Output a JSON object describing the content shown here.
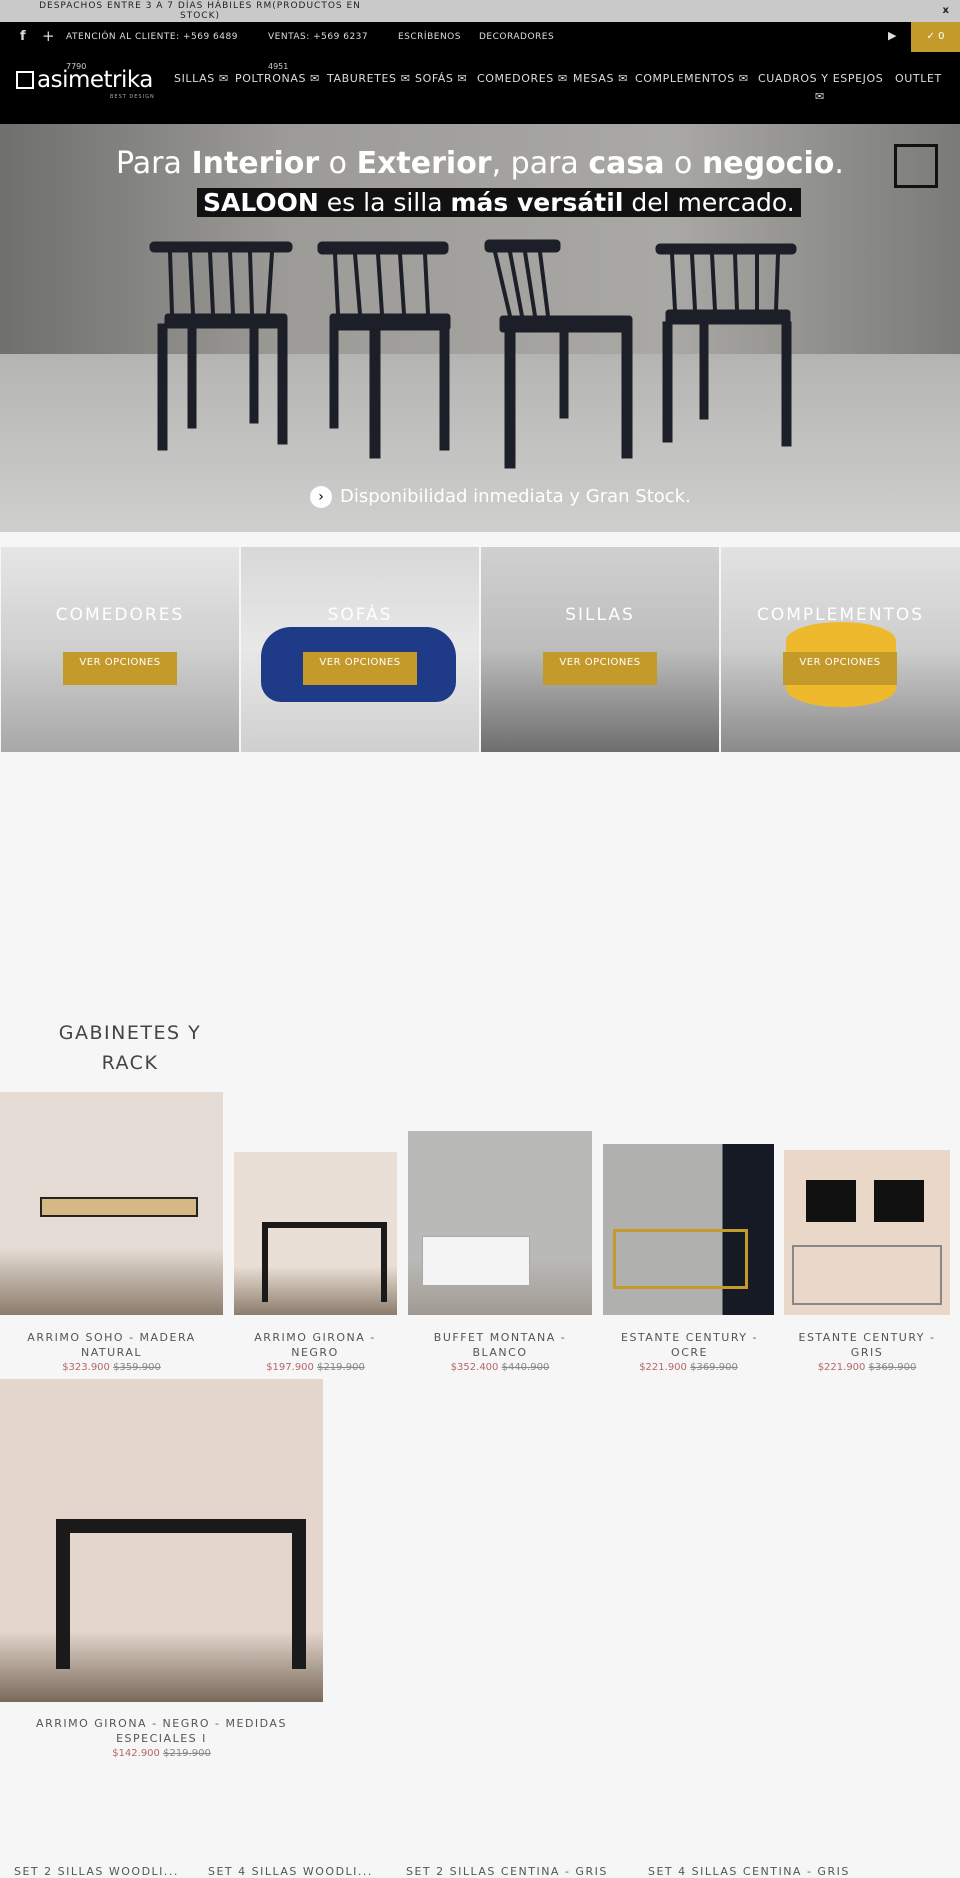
{
  "promo": {
    "text": "DESPACHOS ENTRE 3 A 7 DÍAS HÁBILES RM(PRODUCTOS EN STOCK)",
    "close": "x"
  },
  "topbar": {
    "customer": "ATENCIÓN AL CLIENTE: +569 6489",
    "customer_extra": "7790",
    "sales": "VENTAS: +569 6237",
    "sales_extra": "4951",
    "write": "ESCRÍBENOS",
    "decorators": "DECORADORES",
    "cart_count": "✓ 0"
  },
  "logo": {
    "text": "asimetrika",
    "tagline": "BEST DESIGN"
  },
  "nav": [
    "SILLAS ✉",
    "POLTRONAS ✉",
    "TABURETES ✉",
    "SOFÁS ✉",
    "COMEDORES ✉",
    "MESAS ✉",
    "COMPLEMENTOS ✉",
    "CUADROS Y ESPEJOS",
    "OUTLET"
  ],
  "nav_extra_icon": "✉",
  "hero": {
    "line1_a": "Para ",
    "line1_b": "Interior",
    "line1_c": " o ",
    "line1_d": "Exterior",
    "line1_e": ", para ",
    "line1_f": "casa",
    "line1_g": " o ",
    "line1_h": "negocio",
    "line1_i": ".",
    "line2_a": "SALOON",
    "line2_b": " es la silla ",
    "line2_c": "más versátil",
    "line2_d": " del mercado.",
    "cta": "Disponibilidad inmediata y Gran Stock."
  },
  "categories": [
    {
      "label": "COMEDORES",
      "button": "VER OPCIONES"
    },
    {
      "label": "SOFÁS",
      "button": "VER OPCIONES"
    },
    {
      "label": "SILLAS",
      "button": "VER OPCIONES"
    },
    {
      "label": "COMPLEMENTOS",
      "button": "VER OPCIONES"
    }
  ],
  "section_title": "GABINETES Y RACK",
  "products": [
    {
      "name": "ARRIMO SOHO - MADERA NATURAL",
      "price": "$323.900",
      "old_price": "$359.900"
    },
    {
      "name": "ARRIMO GIRONA - NEGRO",
      "price": "$197.900",
      "old_price": "$219.900"
    },
    {
      "name": "BUFFET MONTANA - BLANCO",
      "price": "$352.400",
      "old_price": "$440.900"
    },
    {
      "name": "ESTANTE CENTURY - OCRE",
      "price": "$221.900",
      "old_price": "$369.900"
    },
    {
      "name": "ESTANTE CENTURY - GRIS",
      "price": "$221.900",
      "old_price": "$369.900"
    },
    {
      "name": "ARRIMO GIRONA - NEGRO - MEDIDAS ESPECIALES I",
      "price": "$142.900",
      "old_price": "$219.900"
    }
  ],
  "bottom_titles": [
    "SET 2 SILLAS WOODLI...",
    "SET 4 SILLAS WOODLI...",
    "SET 2 SILLAS CENTINA - GRIS",
    "SET 4 SILLAS CENTINA - GRIS"
  ],
  "colors": {
    "accent": "#c49a2a",
    "sale": "#b5676a",
    "header": "#000000"
  }
}
